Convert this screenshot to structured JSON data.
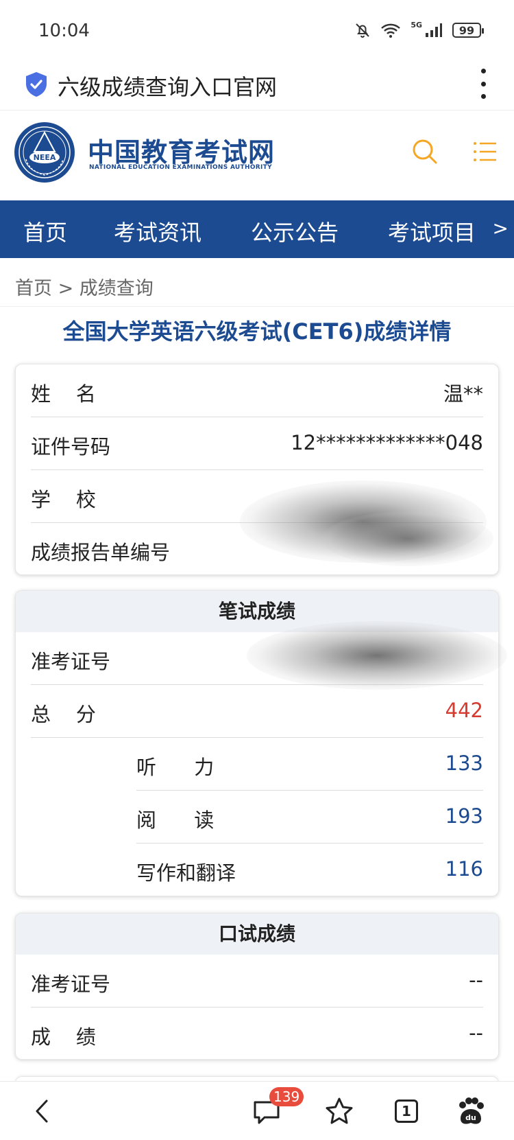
{
  "status_bar": {
    "time": "10:04",
    "network": "5G",
    "battery": "99"
  },
  "browser": {
    "url_title": "六级成绩查询入口官网"
  },
  "site": {
    "name_cn": "中国教育考试网",
    "name_en": "NATIONAL EDUCATION EXAMINATIONS AUTHORITY",
    "emblem_text": "NEEA"
  },
  "nav": {
    "items": [
      "首页",
      "考试资讯",
      "公示公告",
      "考试项目"
    ],
    "more": ">"
  },
  "breadcrumb": "首页 > 成绩查询",
  "page_title": "全国大学英语六级考试(CET6)成绩详情",
  "info_card": {
    "rows": [
      {
        "label": "姓    名",
        "value": "温**"
      },
      {
        "label": "证件号码",
        "value": "12*************048"
      },
      {
        "label": "学    校",
        "value": ""
      },
      {
        "label": "成绩报告单编号",
        "value": ""
      }
    ]
  },
  "written": {
    "header": "笔试成绩",
    "ticket_label": "准考证号",
    "ticket_value": "",
    "total_label": "总    分",
    "total_value": "442",
    "sub_rows": [
      {
        "label": "听      力",
        "value": "133"
      },
      {
        "label": "阅      读",
        "value": "193"
      },
      {
        "label": "写作和翻译",
        "value": "116"
      }
    ]
  },
  "oral": {
    "header": "口试成绩",
    "rows": [
      {
        "label": "准考证号",
        "value": "--"
      },
      {
        "label": "成    绩",
        "value": "--"
      }
    ]
  },
  "toolbar": {
    "badge_count": "139",
    "tab_count": "1"
  },
  "colors": {
    "brand_blue": "#1d4b91",
    "score_red": "#d63a2f",
    "accent_orange": "#f5a623"
  }
}
